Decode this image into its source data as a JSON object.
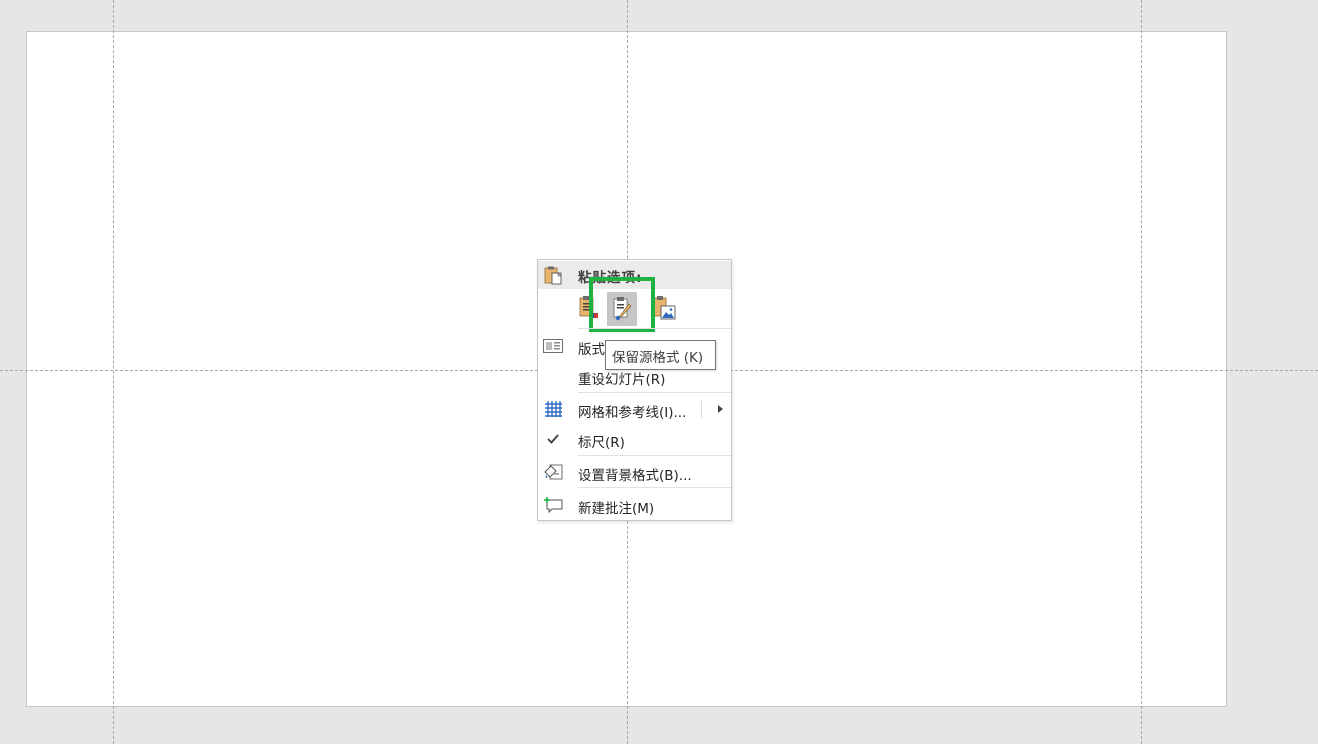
{
  "context_menu": {
    "paste_options_header": "粘贴选项:",
    "paste_buttons": [
      {
        "icon": "paste-use-destination-theme-icon"
      },
      {
        "icon": "paste-keep-source-formatting-icon",
        "active": true
      },
      {
        "icon": "paste-as-picture-icon"
      }
    ],
    "items": [
      {
        "label": "版式",
        "icon": "layout-icon"
      },
      {
        "label": "重设幻灯片(R)",
        "icon": ""
      },
      {
        "label": "网格和参考线(I)...",
        "icon": "grid-icon",
        "has_submenu": true
      },
      {
        "label": "标尺(R)",
        "icon": "checkmark-icon",
        "checked": true
      },
      {
        "label": "设置背景格式(B)...",
        "icon": "format-background-icon"
      },
      {
        "label": "新建批注(M)",
        "icon": "new-comment-icon"
      }
    ]
  },
  "tooltip": {
    "text": "保留源格式 (K)"
  },
  "colors": {
    "background": "#e6e6e6",
    "slide": "#ffffff",
    "highlight_border": "#1fb141",
    "menu_header": "#ebebeb"
  }
}
